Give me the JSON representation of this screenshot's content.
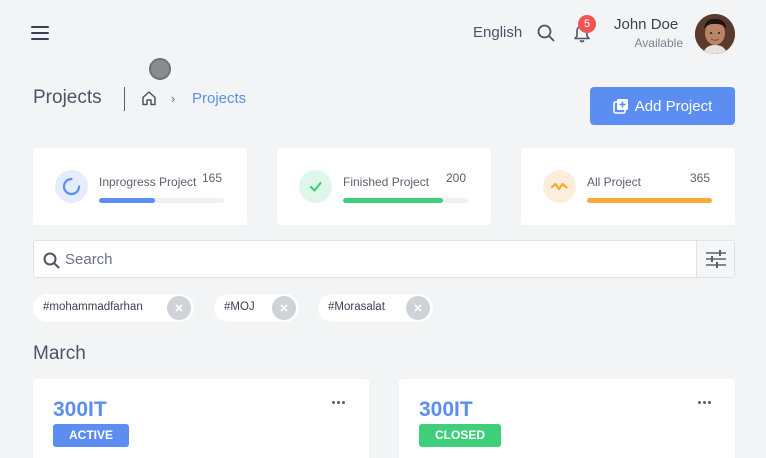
{
  "header": {
    "language": "English",
    "notification_count": "5",
    "user_name": "John Doe",
    "user_status": "Available",
    "icons": [
      "menu-icon",
      "search-icon",
      "bell-icon"
    ]
  },
  "page": {
    "title": "Projects",
    "breadcrumb_current": "Projects",
    "add_button_label": "Add Project"
  },
  "stats": [
    {
      "label": "Inprogress Project",
      "value": "165",
      "color": "#5b8ef0",
      "icon_bg": "#e5edfc",
      "icon": "spinner-icon",
      "progress": 0.45
    },
    {
      "label": "Finished Project",
      "value": "200",
      "color": "#3ecf7a",
      "icon_bg": "#dff7e9",
      "icon": "check-icon",
      "progress": 0.8
    },
    {
      "label": "All Project",
      "value": "365",
      "color": "#f9a83b",
      "icon_bg": "#fdeedb",
      "icon": "pulse-icon",
      "progress": 1.0
    }
  ],
  "search": {
    "placeholder": "Search",
    "value": ""
  },
  "filter_chips": [
    "#mohammadfarhan",
    "#MOJ",
    "#Morasalat"
  ],
  "month": "March",
  "projects": [
    {
      "title": "300IT",
      "status": "ACTIVE",
      "status_color": "#5b8ef0"
    },
    {
      "title": "300IT",
      "status": "CLOSED",
      "status_color": "#3ecf7a"
    }
  ]
}
